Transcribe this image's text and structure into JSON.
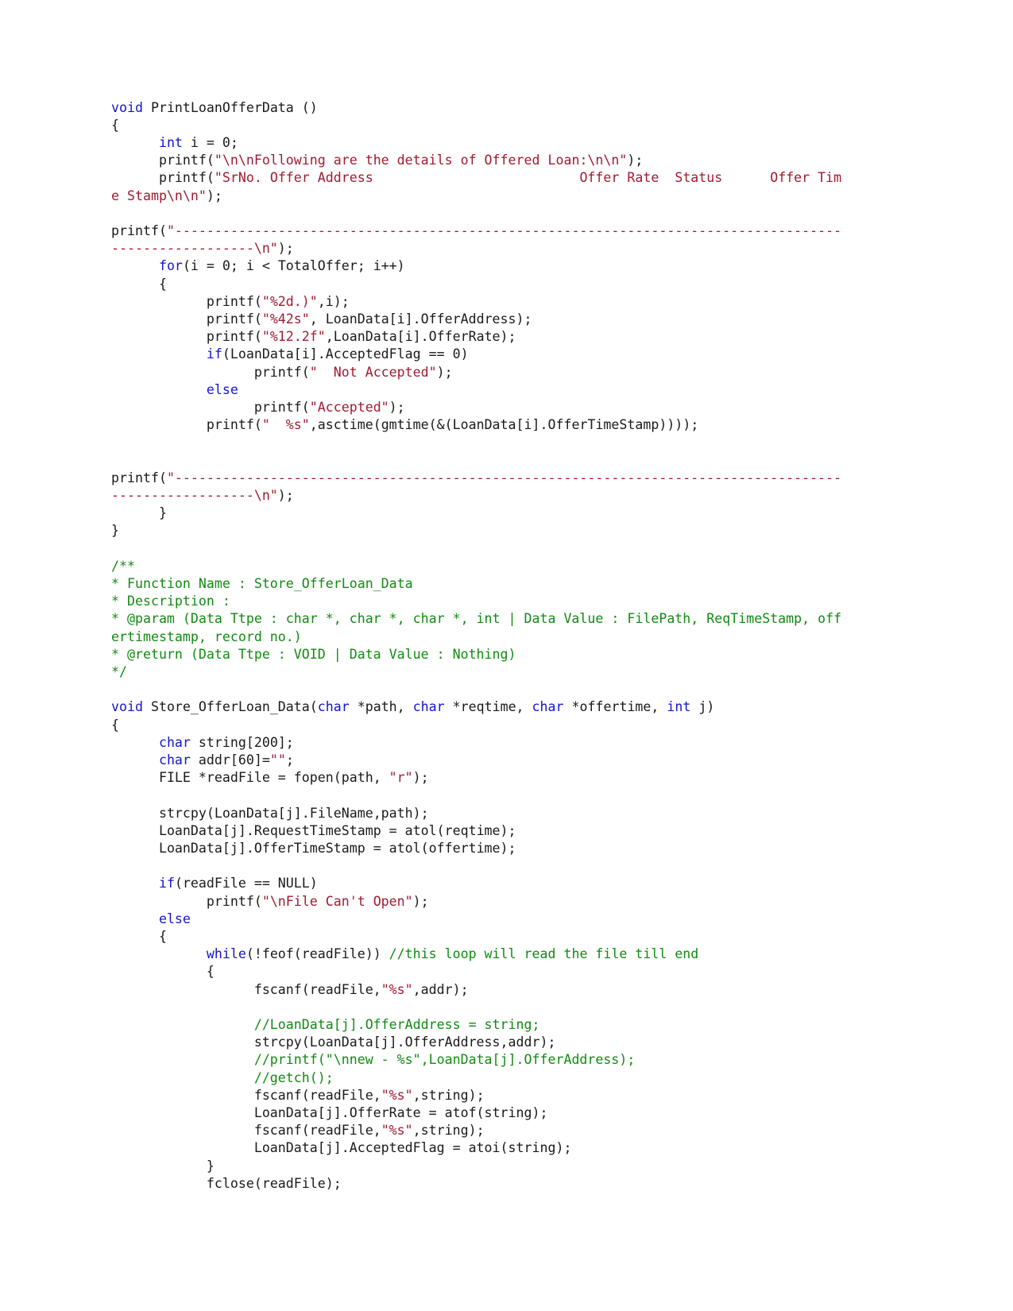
{
  "document": {
    "language": "C",
    "colors": {
      "background": "#ffffff",
      "plain_text": "#1a1a1a",
      "keyword": "#1414cf",
      "string": "#a01b30",
      "comment": "#128a12"
    },
    "lines": [
      {
        "id": "l1",
        "tokens": [
          {
            "t": "kw",
            "v": "void"
          },
          {
            "t": "pln",
            "v": " PrintLoanOfferData ()"
          }
        ]
      },
      {
        "id": "l2",
        "tokens": [
          {
            "t": "pln",
            "v": "{"
          }
        ]
      },
      {
        "id": "l3",
        "tokens": [
          {
            "t": "pln",
            "v": "      "
          },
          {
            "t": "kw",
            "v": "int"
          },
          {
            "t": "pln",
            "v": " i = 0;"
          }
        ]
      },
      {
        "id": "l4",
        "tokens": [
          {
            "t": "pln",
            "v": "      printf("
          },
          {
            "t": "str",
            "v": "\"\\n\\nFollowing are the details of Offered Loan:\\n\\n\""
          },
          {
            "t": "pln",
            "v": ");"
          }
        ]
      },
      {
        "id": "l5",
        "tokens": [
          {
            "t": "pln",
            "v": "      printf("
          },
          {
            "t": "str",
            "v": "\"SrNo. Offer Address                          Offer Rate  Status      Offer Time Stamp\\n\\n\""
          },
          {
            "t": "pln",
            "v": ");"
          }
        ]
      },
      {
        "id": "l6",
        "tokens": []
      },
      {
        "id": "l7",
        "tokens": [
          {
            "t": "pln",
            "v": "printf("
          },
          {
            "t": "str",
            "v": "\"------------------------------------------------------------------------------------------------------\\n\""
          },
          {
            "t": "pln",
            "v": ");"
          }
        ]
      },
      {
        "id": "l8",
        "tokens": [
          {
            "t": "pln",
            "v": "      "
          },
          {
            "t": "kw",
            "v": "for"
          },
          {
            "t": "pln",
            "v": "(i = 0; i < TotalOffer; i++)"
          }
        ]
      },
      {
        "id": "l9",
        "tokens": [
          {
            "t": "pln",
            "v": "      {"
          }
        ]
      },
      {
        "id": "l10",
        "tokens": [
          {
            "t": "pln",
            "v": "            printf("
          },
          {
            "t": "str",
            "v": "\"%2d.)\""
          },
          {
            "t": "pln",
            "v": ",i);"
          }
        ]
      },
      {
        "id": "l11",
        "tokens": [
          {
            "t": "pln",
            "v": "            printf("
          },
          {
            "t": "str",
            "v": "\"%42s\""
          },
          {
            "t": "pln",
            "v": ", LoanData[i].OfferAddress);"
          }
        ]
      },
      {
        "id": "l12",
        "tokens": [
          {
            "t": "pln",
            "v": "            printf("
          },
          {
            "t": "str",
            "v": "\"%12.2f\""
          },
          {
            "t": "pln",
            "v": ",LoanData[i].OfferRate);"
          }
        ]
      },
      {
        "id": "l13",
        "tokens": [
          {
            "t": "pln",
            "v": "            "
          },
          {
            "t": "kw",
            "v": "if"
          },
          {
            "t": "pln",
            "v": "(LoanData[i].AcceptedFlag == 0)"
          }
        ]
      },
      {
        "id": "l14",
        "tokens": [
          {
            "t": "pln",
            "v": "                  printf("
          },
          {
            "t": "str",
            "v": "\"  Not Accepted\""
          },
          {
            "t": "pln",
            "v": ");"
          }
        ]
      },
      {
        "id": "l15",
        "tokens": [
          {
            "t": "pln",
            "v": "            "
          },
          {
            "t": "kw",
            "v": "else"
          }
        ]
      },
      {
        "id": "l16",
        "tokens": [
          {
            "t": "pln",
            "v": "                  printf("
          },
          {
            "t": "str",
            "v": "\"Accepted\""
          },
          {
            "t": "pln",
            "v": ");"
          }
        ]
      },
      {
        "id": "l17",
        "tokens": [
          {
            "t": "pln",
            "v": "            printf("
          },
          {
            "t": "str",
            "v": "\"  %s\""
          },
          {
            "t": "pln",
            "v": ",asctime(gmtime(&(LoanData[i].OfferTimeStamp))));"
          }
        ]
      },
      {
        "id": "l18",
        "tokens": []
      },
      {
        "id": "l19",
        "tokens": []
      },
      {
        "id": "l20",
        "tokens": [
          {
            "t": "pln",
            "v": "printf("
          },
          {
            "t": "str",
            "v": "\"------------------------------------------------------------------------------------------------------\\n\""
          },
          {
            "t": "pln",
            "v": ");"
          }
        ]
      },
      {
        "id": "l21",
        "tokens": [
          {
            "t": "pln",
            "v": "      }"
          }
        ]
      },
      {
        "id": "l22",
        "tokens": [
          {
            "t": "pln",
            "v": "}"
          }
        ]
      },
      {
        "id": "l23",
        "tokens": []
      },
      {
        "id": "l24",
        "tokens": [
          {
            "t": "cmt",
            "v": "/**"
          }
        ]
      },
      {
        "id": "l25",
        "tokens": [
          {
            "t": "cmt",
            "v": "* Function Name : Store_OfferLoan_Data"
          }
        ]
      },
      {
        "id": "l26",
        "tokens": [
          {
            "t": "cmt",
            "v": "* Description :"
          }
        ]
      },
      {
        "id": "l27",
        "tokens": [
          {
            "t": "cmt",
            "v": "* @param (Data Ttpe : char *, char *, char *, int | Data Value : FilePath, ReqTimeStamp, offertimestamp, record no.)"
          }
        ]
      },
      {
        "id": "l28",
        "tokens": [
          {
            "t": "cmt",
            "v": "* @return (Data Ttpe : VOID | Data Value : Nothing)"
          }
        ]
      },
      {
        "id": "l29",
        "tokens": [
          {
            "t": "cmt",
            "v": "*/"
          }
        ]
      },
      {
        "id": "l30",
        "tokens": []
      },
      {
        "id": "l31",
        "tokens": [
          {
            "t": "kw",
            "v": "void"
          },
          {
            "t": "pln",
            "v": " Store_OfferLoan_Data("
          },
          {
            "t": "kw",
            "v": "char"
          },
          {
            "t": "pln",
            "v": " *path, "
          },
          {
            "t": "kw",
            "v": "char"
          },
          {
            "t": "pln",
            "v": " *reqtime, "
          },
          {
            "t": "kw",
            "v": "char"
          },
          {
            "t": "pln",
            "v": " *offertime, "
          },
          {
            "t": "kw",
            "v": "int"
          },
          {
            "t": "pln",
            "v": " j)"
          }
        ]
      },
      {
        "id": "l32",
        "tokens": [
          {
            "t": "pln",
            "v": "{"
          }
        ]
      },
      {
        "id": "l33",
        "tokens": [
          {
            "t": "pln",
            "v": "      "
          },
          {
            "t": "kw",
            "v": "char"
          },
          {
            "t": "pln",
            "v": " string[200];"
          }
        ]
      },
      {
        "id": "l34",
        "tokens": [
          {
            "t": "pln",
            "v": "      "
          },
          {
            "t": "kw",
            "v": "char"
          },
          {
            "t": "pln",
            "v": " addr[60]="
          },
          {
            "t": "str",
            "v": "\"\""
          },
          {
            "t": "pln",
            "v": ";"
          }
        ]
      },
      {
        "id": "l35",
        "tokens": [
          {
            "t": "pln",
            "v": "      FILE *readFile = fopen(path, "
          },
          {
            "t": "str",
            "v": "\"r\""
          },
          {
            "t": "pln",
            "v": ");"
          }
        ]
      },
      {
        "id": "l36",
        "tokens": []
      },
      {
        "id": "l37",
        "tokens": [
          {
            "t": "pln",
            "v": "      strcpy(LoanData[j].FileName,path);"
          }
        ]
      },
      {
        "id": "l38",
        "tokens": [
          {
            "t": "pln",
            "v": "      LoanData[j].RequestTimeStamp = atol(reqtime);"
          }
        ]
      },
      {
        "id": "l39",
        "tokens": [
          {
            "t": "pln",
            "v": "      LoanData[j].OfferTimeStamp = atol(offertime);"
          }
        ]
      },
      {
        "id": "l40",
        "tokens": []
      },
      {
        "id": "l41",
        "tokens": [
          {
            "t": "pln",
            "v": "      "
          },
          {
            "t": "kw",
            "v": "if"
          },
          {
            "t": "pln",
            "v": "(readFile == NULL)"
          }
        ]
      },
      {
        "id": "l42",
        "tokens": [
          {
            "t": "pln",
            "v": "            printf("
          },
          {
            "t": "str",
            "v": "\"\\nFile Can't Open\""
          },
          {
            "t": "pln",
            "v": ");"
          }
        ]
      },
      {
        "id": "l43",
        "tokens": [
          {
            "t": "pln",
            "v": "      "
          },
          {
            "t": "kw",
            "v": "else"
          }
        ]
      },
      {
        "id": "l44",
        "tokens": [
          {
            "t": "pln",
            "v": "      {"
          }
        ]
      },
      {
        "id": "l45",
        "tokens": [
          {
            "t": "pln",
            "v": "            "
          },
          {
            "t": "kw",
            "v": "while"
          },
          {
            "t": "pln",
            "v": "(!feof(readFile)) "
          },
          {
            "t": "cmt",
            "v": "//this loop will read the file till end"
          }
        ]
      },
      {
        "id": "l46",
        "tokens": [
          {
            "t": "pln",
            "v": "            {"
          }
        ]
      },
      {
        "id": "l47",
        "tokens": [
          {
            "t": "pln",
            "v": "                  fscanf(readFile,"
          },
          {
            "t": "str",
            "v": "\"%s\""
          },
          {
            "t": "pln",
            "v": ",addr);"
          }
        ]
      },
      {
        "id": "l48",
        "tokens": []
      },
      {
        "id": "l49",
        "tokens": [
          {
            "t": "pln",
            "v": "                  "
          },
          {
            "t": "cmt",
            "v": "//LoanData[j].OfferAddress = string;"
          }
        ]
      },
      {
        "id": "l50",
        "tokens": [
          {
            "t": "pln",
            "v": "                  strcpy(LoanData[j].OfferAddress,addr);"
          }
        ]
      },
      {
        "id": "l51",
        "tokens": [
          {
            "t": "pln",
            "v": "                  "
          },
          {
            "t": "cmt",
            "v": "//printf(\"\\nnew - %s\",LoanData[j].OfferAddress);"
          }
        ]
      },
      {
        "id": "l52",
        "tokens": [
          {
            "t": "pln",
            "v": "                  "
          },
          {
            "t": "cmt",
            "v": "//getch();"
          }
        ]
      },
      {
        "id": "l53",
        "tokens": [
          {
            "t": "pln",
            "v": "                  fscanf(readFile,"
          },
          {
            "t": "str",
            "v": "\"%s\""
          },
          {
            "t": "pln",
            "v": ",string);"
          }
        ]
      },
      {
        "id": "l54",
        "tokens": [
          {
            "t": "pln",
            "v": "                  LoanData[j].OfferRate = atof(string);"
          }
        ]
      },
      {
        "id": "l55",
        "tokens": [
          {
            "t": "pln",
            "v": "                  fscanf(readFile,"
          },
          {
            "t": "str",
            "v": "\"%s\""
          },
          {
            "t": "pln",
            "v": ",string);"
          }
        ]
      },
      {
        "id": "l56",
        "tokens": [
          {
            "t": "pln",
            "v": "                  LoanData[j].AcceptedFlag = atoi(string);"
          }
        ]
      },
      {
        "id": "l57",
        "tokens": [
          {
            "t": "pln",
            "v": "            }"
          }
        ]
      },
      {
        "id": "l58",
        "tokens": [
          {
            "t": "pln",
            "v": "            fclose(readFile);"
          }
        ]
      }
    ]
  }
}
